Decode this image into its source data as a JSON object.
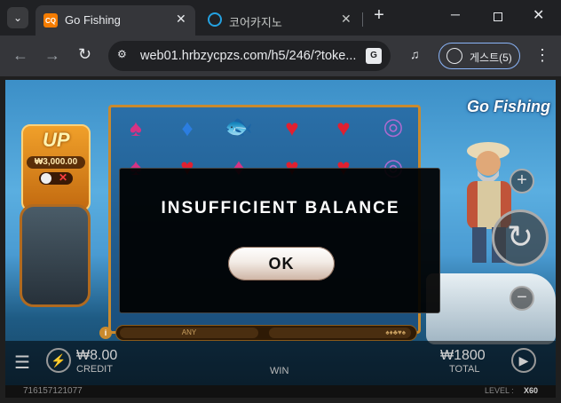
{
  "browser": {
    "tabs": [
      {
        "title": "Go Fishing",
        "favicon": "game-favicon",
        "active": true
      },
      {
        "title": "코어카지노",
        "favicon": "circle-favicon",
        "active": false
      }
    ],
    "url": "web01.hrbzycpzs.com/h5/246/?toke...",
    "profile_label": "게스트(5)",
    "icons": {
      "new_tab": "+",
      "close": "✕",
      "minimize": "─",
      "back": "←",
      "forward": "→",
      "reload": "↻",
      "menu": "⋮"
    }
  },
  "game": {
    "logo": "Go Fishing",
    "up_label": "UP",
    "up_amount": "₩3,000.00",
    "reel_bar": {
      "left": "ANY",
      "right": ""
    },
    "hud": {
      "credit_value": "₩8.00",
      "credit_label": "CREDIT",
      "win_label": "WIN",
      "total_value": "₩1800",
      "total_label": "TOTAL"
    },
    "footer": {
      "game_id": "716157121077",
      "level_label": "LEVEL :",
      "level_value": "X60"
    }
  },
  "modal": {
    "title": "INSUFFICIENT BALANCE",
    "ok_label": "OK"
  },
  "colors": {
    "chrome_dark": "#202124",
    "chrome_toolbar": "#35363a",
    "modal_bg": "#000000",
    "accent_blue": "#8ab4f8"
  }
}
